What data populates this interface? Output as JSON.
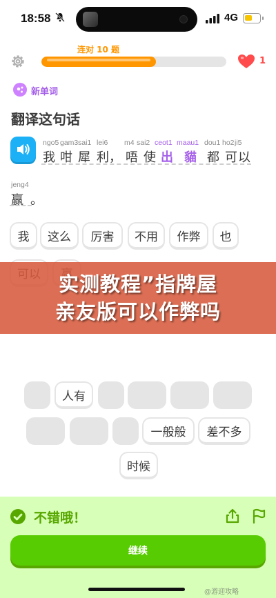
{
  "status_bar": {
    "time": "18:58",
    "network": "4G",
    "battery_level": 0.55,
    "battery_color": "#f7c400"
  },
  "header": {
    "streak_label": "连对 10 题",
    "progress": 0.62,
    "hearts": "1",
    "accent": "#ff9600",
    "heart_color": "#ff4b4b"
  },
  "lesson": {
    "new_word_label": "新单词",
    "prompt": "翻译这句话",
    "sentence": [
      {
        "pinyin": "ngo5",
        "hanzi": "我",
        "is_new": false
      },
      {
        "pinyin": "gam3",
        "hanzi": "咁",
        "is_new": false
      },
      {
        "pinyin": "sai1",
        "hanzi": "犀",
        "is_new": false
      },
      {
        "pinyin": "lei6",
        "hanzi": "利，",
        "is_new": false
      },
      {
        "pinyin": "m4",
        "hanzi": "唔",
        "is_new": false
      },
      {
        "pinyin": "sai2",
        "hanzi": "使",
        "is_new": false
      },
      {
        "pinyin": "ceot1",
        "hanzi": "出",
        "is_new": true
      },
      {
        "pinyin": "maau1",
        "hanzi": "貓",
        "is_new": true
      },
      {
        "pinyin": "dou1",
        "hanzi": "都",
        "is_new": false
      },
      {
        "pinyin": "ho2",
        "hanzi": "可",
        "is_new": false
      },
      {
        "pinyin": "ji5",
        "hanzi": "以",
        "is_new": false
      },
      {
        "pinyin": "jeng4",
        "hanzi": "赢",
        "is_new": false
      },
      {
        "pinyin": "",
        "hanzi": "。",
        "is_new": false
      }
    ]
  },
  "answer_tiles": [
    "我",
    "这么",
    "厉害",
    "不用",
    "作弊",
    "也",
    "可以",
    "赢"
  ],
  "overlay_banner": {
    "line1": "实测教程”指牌屋",
    "line2": "亲友版可以作弊吗"
  },
  "word_bank": {
    "row1": [
      "",
      "人有",
      "",
      "",
      "",
      ""
    ],
    "row2": [
      "",
      "",
      "",
      "一般般",
      "差不多"
    ],
    "row3": [
      "时候"
    ]
  },
  "feedback": {
    "title": "不错哦！",
    "continue_label": "继续",
    "color": "#58a700"
  },
  "watermark": "@游迎攻略"
}
